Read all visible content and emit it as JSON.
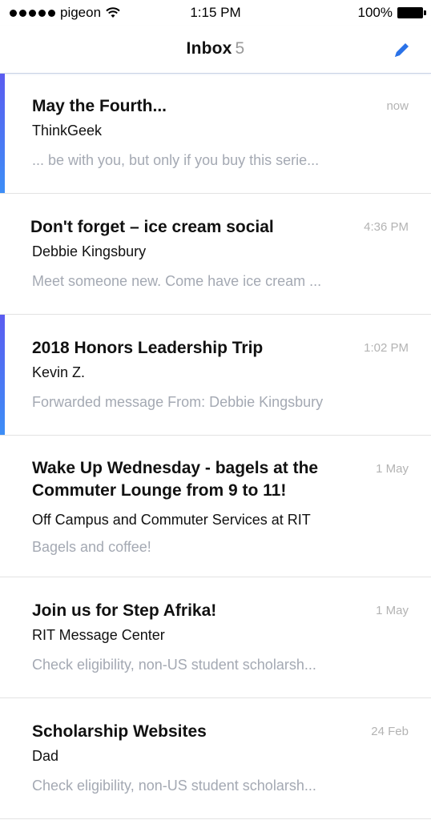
{
  "status_bar": {
    "carrier": "pigeon",
    "time": "1:15 PM",
    "battery": "100%"
  },
  "nav": {
    "title": "Inbox",
    "count": "5"
  },
  "messages": [
    {
      "subject": "May the Fourth...",
      "time": "now",
      "sender": "ThinkGeek",
      "preview": "... be with you, but only if you buy this serie...",
      "unread": true
    },
    {
      "subject": "Don't forget – ice cream social",
      "time": "4:36 PM",
      "sender": "Debbie Kingsbury",
      "preview": "Meet someone new. Come have ice cream ...",
      "unread": false
    },
    {
      "subject": "2018 Honors Leadership Trip",
      "time": "1:02 PM",
      "sender": "Kevin Z.",
      "preview": "Forwarded message From: Debbie Kingsbury",
      "unread": true
    },
    {
      "subject": "Wake Up Wednesday - bagels at the Commuter Lounge from 9 to 11!",
      "time": "1 May",
      "sender": "Off Campus and Commuter Services at RIT",
      "preview": "Bagels and coffee!",
      "unread": false
    },
    {
      "subject": "Join us for Step Afrika!",
      "time": "1 May",
      "sender": "RIT Message Center",
      "preview": "Check eligibility, non-US student scholarsh...",
      "unread": false
    },
    {
      "subject": "Scholarship Websites",
      "time": "24 Feb",
      "sender": "Dad",
      "preview": "Check eligibility, non-US student scholarsh...",
      "unread": false
    }
  ],
  "colors": {
    "unread_bar_top": "#5b5cf0",
    "unread_bar_bottom": "#3d8ef6",
    "compose_icon": "#2a72e8",
    "preview_text": "#a4a9b3"
  }
}
